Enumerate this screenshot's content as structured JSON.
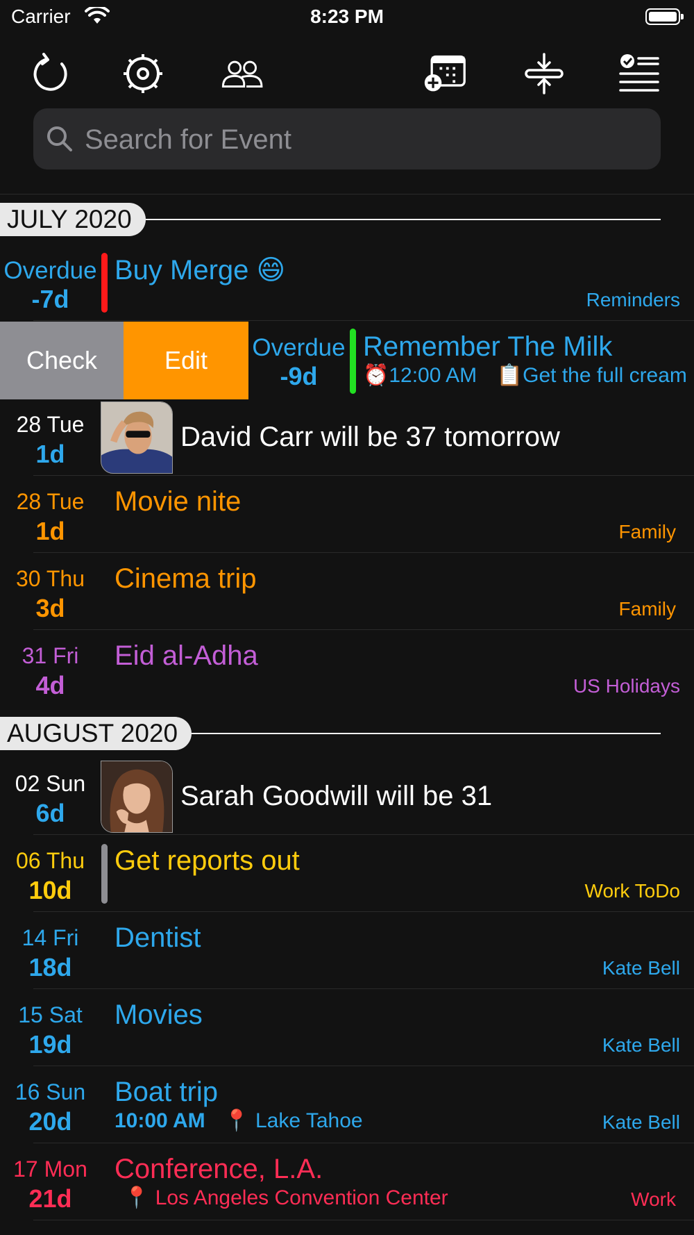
{
  "status_bar": {
    "carrier": "Carrier",
    "time": "8:23 PM"
  },
  "toolbar": {
    "icons": [
      "refresh-icon",
      "settings-icon",
      "contacts-icon",
      "add-event-icon",
      "collapse-icon",
      "tasks-icon"
    ]
  },
  "search": {
    "placeholder": "Search for Event",
    "value": ""
  },
  "sections": [
    {
      "label": "JULY 2020"
    },
    {
      "label": "AUGUST 2020"
    }
  ],
  "rows": {
    "r1": {
      "date": "Overdue",
      "days": "-7d",
      "title": "Buy Merge 😄",
      "calendar": "Reminders",
      "color": "#2ea8ec",
      "bar": "#ff1a1a"
    },
    "r2": {
      "date": "Overdue",
      "days": "-9d",
      "title": "Remember The Milk",
      "sub_time": "⏰12:00 AM",
      "sub_note": "📋Get the full cream",
      "color": "#2ea8ec",
      "bar": "#22e022"
    },
    "r3": {
      "date": "28 Tue",
      "days": "1d",
      "title": "David Carr will be 37 tomorrow"
    },
    "r4": {
      "date": "28 Tue",
      "days": "1d",
      "title": "Movie nite",
      "calendar": "Family",
      "color": "#ff9500"
    },
    "r5": {
      "date": "30 Thu",
      "days": "3d",
      "title": "Cinema trip",
      "calendar": "Family",
      "color": "#ff9500"
    },
    "r6": {
      "date": "31 Fri",
      "days": "4d",
      "title": "Eid al-Adha",
      "calendar": "US Holidays",
      "color": "#c35ed6"
    },
    "r7": {
      "date": "02 Sun",
      "days": "6d",
      "title": "Sarah Goodwill will be 31"
    },
    "r8": {
      "date": "06 Thu",
      "days": "10d",
      "title": "Get reports out",
      "calendar": "Work ToDo",
      "color": "#ffcc0d",
      "bar": "#8e8e93"
    },
    "r9": {
      "date": "14 Fri",
      "days": "18d",
      "title": "Dentist",
      "calendar": "Kate Bell",
      "color": "#2ea8ec"
    },
    "r10": {
      "date": "15 Sat",
      "days": "19d",
      "title": "Movies",
      "calendar": "Kate Bell",
      "color": "#2ea8ec"
    },
    "r11": {
      "date": "16 Sun",
      "days": "20d",
      "title": "Boat trip",
      "sub_time": "10:00 AM",
      "sub_location": "📍 Lake Tahoe",
      "calendar": "Kate Bell",
      "color": "#2ea8ec"
    },
    "r12": {
      "date": "17 Mon",
      "days": "21d",
      "title": "Conference, L.A.",
      "sub_location": "📍 Los Angeles Convention Center",
      "calendar": "Work",
      "color": "#ff2d55"
    }
  },
  "swipe_actions": {
    "check": "Check",
    "edit": "Edit"
  }
}
